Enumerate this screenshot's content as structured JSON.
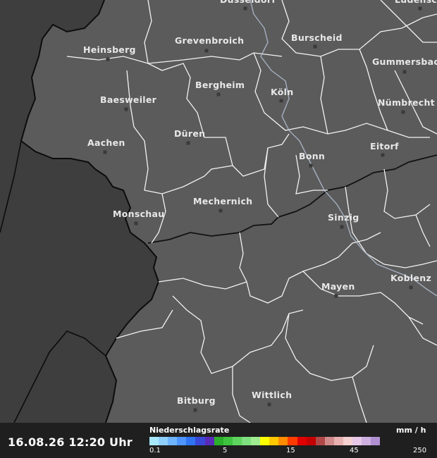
{
  "cities": [
    {
      "name": "Düsseldorf",
      "label": "Düsseldorf"
    },
    {
      "name": "Lüdenscheid",
      "label": "Lüdenscheid"
    },
    {
      "name": "Heinsberg",
      "label": "Heinsberg"
    },
    {
      "name": "Grevenbroich",
      "label": "Grevenbroich"
    },
    {
      "name": "Burscheid",
      "label": "Burscheid"
    },
    {
      "name": "Gummersbach",
      "label": "Gummersbach"
    },
    {
      "name": "Bergheim",
      "label": "Bergheim"
    },
    {
      "name": "Köln",
      "label": "Köln"
    },
    {
      "name": "Baesweiler",
      "label": "Baesweiler"
    },
    {
      "name": "Nümbrecht",
      "label": "Nümbrecht"
    },
    {
      "name": "Düren",
      "label": "Düren"
    },
    {
      "name": "Aachen",
      "label": "Aachen"
    },
    {
      "name": "Eitorf",
      "label": "Eitorf"
    },
    {
      "name": "Bonn",
      "label": "Bonn"
    },
    {
      "name": "Mechernich",
      "label": "Mechernich"
    },
    {
      "name": "Monschau",
      "label": "Monschau"
    },
    {
      "name": "Sinzig",
      "label": "Sinzig"
    },
    {
      "name": "Mayen",
      "label": "Mayen"
    },
    {
      "name": "Koblenz",
      "label": "Koblenz"
    },
    {
      "name": "Wittlich",
      "label": "Wittlich"
    },
    {
      "name": "Bitburg",
      "label": "Bitburg"
    }
  ],
  "legend": {
    "timestamp": "16.08.26 12:20 Uhr",
    "title": "Niederschlagsrate",
    "unit": "mm / h",
    "ticks": [
      "0.1",
      "5",
      "15",
      "45",
      "250"
    ],
    "colors": [
      "#a8e8ff",
      "#8fd0ff",
      "#6fb4ff",
      "#4f95ff",
      "#2f74f0",
      "#3a48d8",
      "#5a2ab8",
      "#2ab02a",
      "#3fc43f",
      "#5fd45f",
      "#7fe07f",
      "#a0ec90",
      "#ffff00",
      "#ffc800",
      "#ff8c00",
      "#ff3c00",
      "#e00000",
      "#c40000",
      "#b04848",
      "#d08a8a",
      "#e8b0b0",
      "#f4d0d0",
      "#e8c8e8",
      "#d0b0e0",
      "#b090d0"
    ]
  },
  "colors": {
    "land": "#5a5a5a",
    "outside_area": "#3c3c3c",
    "border_country": "#000000",
    "border_district": "#ffffff",
    "legend_bg": "#1f1f1f"
  }
}
